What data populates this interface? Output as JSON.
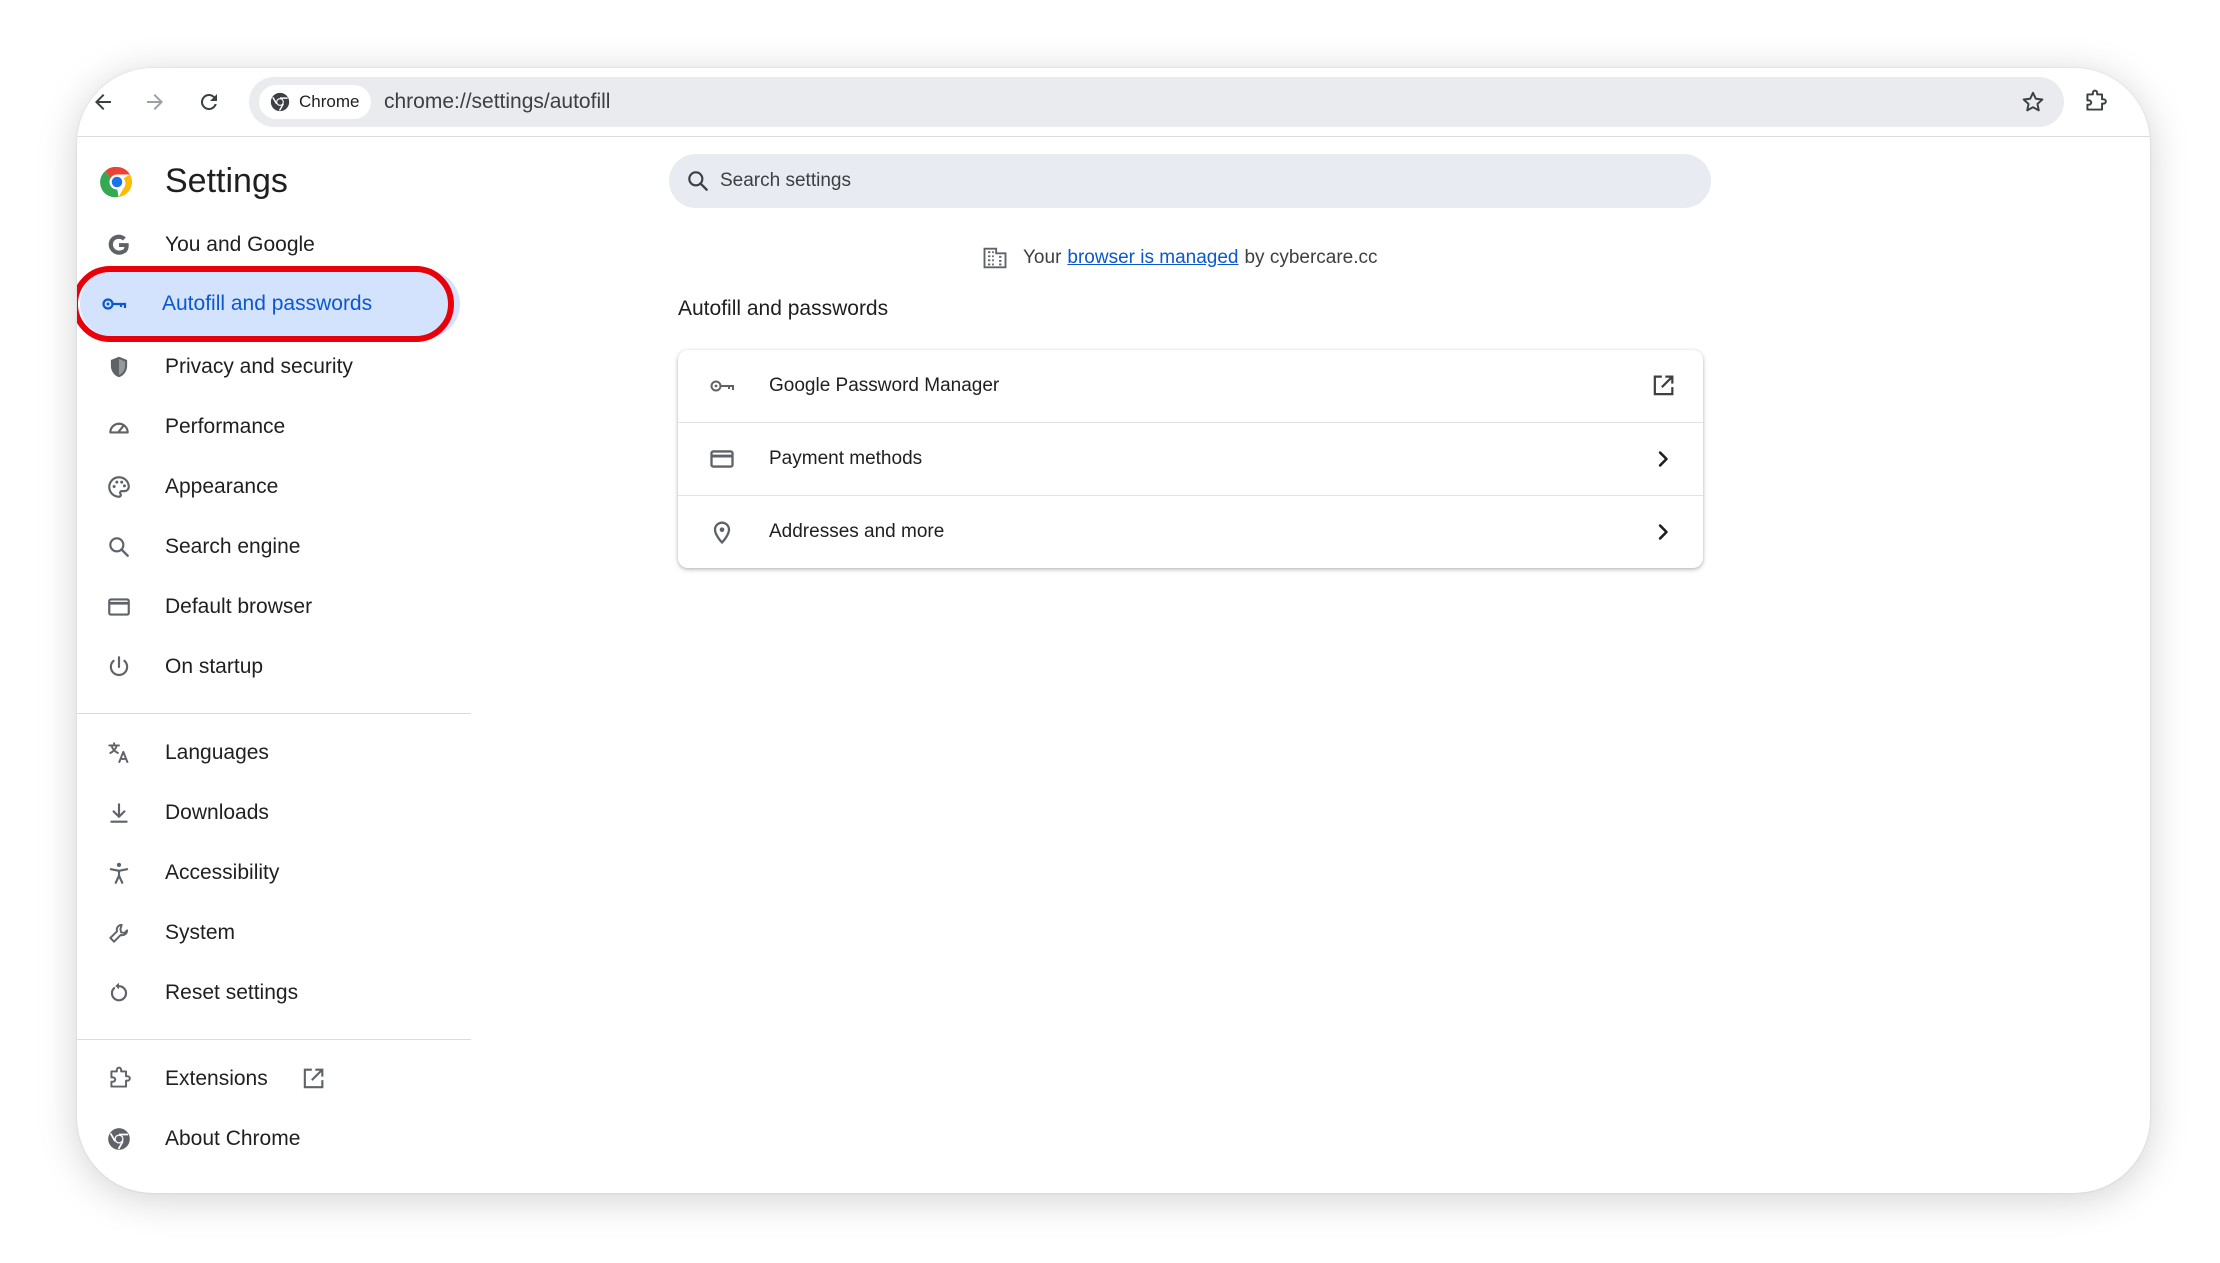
{
  "toolbar": {
    "chip_label": "Chrome",
    "url": "chrome://settings/autofill"
  },
  "header": {
    "title": "Settings"
  },
  "search": {
    "placeholder": "Search settings"
  },
  "managed": {
    "prefix": "Your",
    "link": "browser is managed",
    "suffix": "by cybercare.cc"
  },
  "sidebar": {
    "items": [
      {
        "label": "You and Google",
        "icon": "google-g-icon"
      },
      {
        "label": "Autofill and passwords",
        "icon": "key-icon",
        "active": true
      },
      {
        "label": "Privacy and security",
        "icon": "shield-icon"
      },
      {
        "label": "Performance",
        "icon": "speedometer-icon"
      },
      {
        "label": "Appearance",
        "icon": "palette-icon"
      },
      {
        "label": "Search engine",
        "icon": "search-icon"
      },
      {
        "label": "Default browser",
        "icon": "browser-window-icon"
      },
      {
        "label": "On startup",
        "icon": "power-icon"
      },
      {
        "label": "Languages",
        "icon": "translate-icon"
      },
      {
        "label": "Downloads",
        "icon": "download-icon"
      },
      {
        "label": "Accessibility",
        "icon": "accessibility-icon"
      },
      {
        "label": "System",
        "icon": "wrench-icon"
      },
      {
        "label": "Reset settings",
        "icon": "reset-icon"
      },
      {
        "label": "Extensions",
        "icon": "puzzle-icon"
      },
      {
        "label": "About Chrome",
        "icon": "chrome-icon"
      }
    ]
  },
  "main": {
    "section_title": "Autofill and passwords",
    "rows": [
      {
        "label": "Google Password Manager",
        "icon": "key-icon",
        "trailing": "open-external-icon"
      },
      {
        "label": "Payment methods",
        "icon": "credit-card-icon",
        "trailing": "chevron-right-icon"
      },
      {
        "label": "Addresses and more",
        "icon": "location-pin-icon",
        "trailing": "chevron-right-icon"
      }
    ]
  },
  "colors": {
    "accent": "#0b57d0",
    "active_bg": "#d3e3fd",
    "highlight": "#e8000b"
  }
}
